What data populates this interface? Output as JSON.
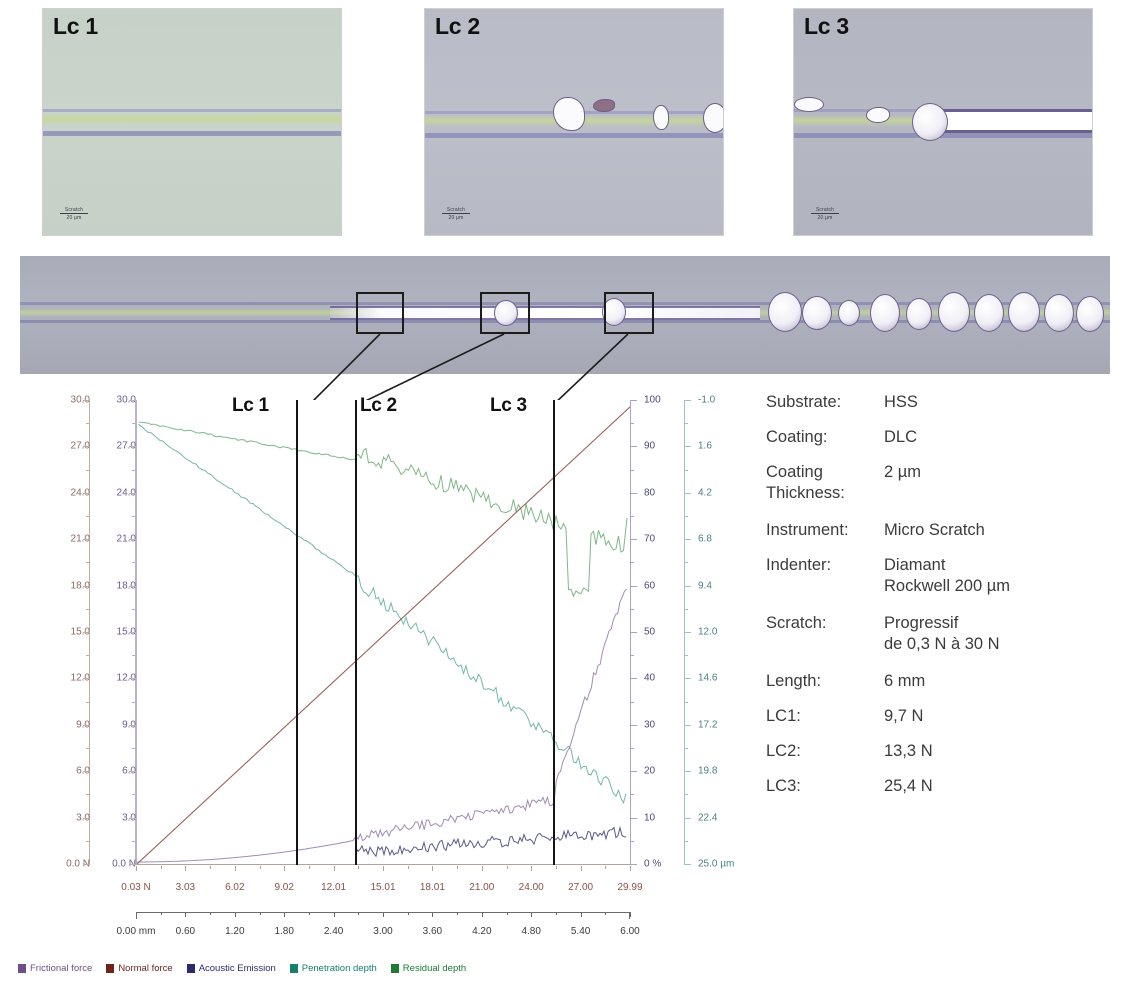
{
  "micrographs": [
    {
      "label": "Lc 1",
      "scale_value": "20 µm",
      "scale_top": "Scratch"
    },
    {
      "label": "Lc 2",
      "scale_value": "20 µm",
      "scale_top": "Scratch"
    },
    {
      "label": "Lc 3",
      "scale_value": "20 µm",
      "scale_top": "Scratch"
    }
  ],
  "chart_data": {
    "type": "line",
    "title": "",
    "xlabel": "",
    "ylabel": "",
    "grid": true,
    "legend_position": "bottom",
    "axes": {
      "normal_force": {
        "label": "0.0 N",
        "unit": "N",
        "color": "#8c6a62",
        "range": [
          0,
          30
        ],
        "ticks": [
          "30.0",
          "27.0",
          "24.0",
          "21.0",
          "18.0",
          "15.0",
          "12.0",
          "9.0",
          "6.0",
          "3.0",
          "0.0 N"
        ]
      },
      "frictional_force": {
        "label": "0.0 N",
        "unit": "N",
        "color": "#6d5d8f",
        "range": [
          0,
          30
        ],
        "ticks": [
          "30.0",
          "27.0",
          "24.0",
          "21.0",
          "18.0",
          "15.0",
          "12.0",
          "9.0",
          "6.0",
          "3.0",
          "0.0 N"
        ]
      },
      "acoustic_emission": {
        "unit": "%",
        "color": "#4d4a7a",
        "range": [
          0,
          100
        ],
        "ticks": [
          "100",
          "90",
          "80",
          "70",
          "60",
          "50",
          "40",
          "30",
          "20",
          "10",
          "0 %"
        ]
      },
      "depth": {
        "unit": "µm",
        "color": "#4b7f84",
        "range": [
          -1.0,
          25.0
        ],
        "ticks": [
          "-1.0",
          "1.6",
          "4.2",
          "6.8",
          "9.4",
          "12.0",
          "14.6",
          "17.2",
          "19.8",
          "22.4",
          "25.0 µm"
        ]
      },
      "x_force": {
        "unit": "N",
        "color": "#8c4f46",
        "ticks": [
          "0.03 N",
          "3.03",
          "6.02",
          "9.02",
          "12.01",
          "15.01",
          "18.01",
          "21.00",
          "24.00",
          "27.00",
          "29.99"
        ]
      },
      "x_position": {
        "unit": "mm",
        "color": "#3a3a3a",
        "ticks": [
          "0.00 mm",
          "0.60",
          "1.20",
          "1.80",
          "2.40",
          "3.00",
          "3.60",
          "4.20",
          "4.80",
          "5.40",
          "6.00"
        ]
      }
    },
    "markers": [
      {
        "label": "Lc 1",
        "force_n": 9.7,
        "x_fraction": 0.323
      },
      {
        "label": "Lc 2",
        "force_n": 13.3,
        "x_fraction": 0.443
      },
      {
        "label": "Lc 3",
        "force_n": 25.4,
        "x_fraction": 0.845
      }
    ],
    "series": [
      {
        "name": "Frictional force",
        "color": "#7b5a93"
      },
      {
        "name": "Normal force",
        "color": "#7a2b24"
      },
      {
        "name": "Acoustic Emission",
        "color": "#2f2f6e"
      },
      {
        "name": "Penetration depth",
        "color": "#1f8a78"
      },
      {
        "name": "Residual depth",
        "color": "#2f8a3f"
      }
    ],
    "legend": [
      {
        "label": "Frictional force",
        "color": "#6f4f88"
      },
      {
        "label": "Normal force",
        "color": "#6e241d"
      },
      {
        "label": "Acoustic Emission",
        "color": "#2b2b6b"
      },
      {
        "label": "Penetration depth",
        "color": "#15806d"
      },
      {
        "label": "Residual depth",
        "color": "#1f7a33"
      }
    ]
  },
  "info": {
    "rows": [
      {
        "key": "Substrate:",
        "value": "HSS"
      },
      {
        "key": "Coating:",
        "value": "DLC"
      },
      {
        "key": "Coating\nThickness:",
        "value": "2 µm"
      },
      {
        "key": "Instrument:",
        "value": "Micro Scratch"
      },
      {
        "key": "Indenter:",
        "value": "Diamant\nRockwell 200 µm"
      },
      {
        "key": "Scratch:",
        "value": "Progressif\nde 0,3 N à 30 N"
      },
      {
        "key": "Length:",
        "value": "6 mm"
      },
      {
        "key": "LC1:",
        "value": "9,7 N"
      },
      {
        "key": "LC2:",
        "value": "13,3 N"
      },
      {
        "key": "LC3:",
        "value": "25,4 N"
      }
    ]
  }
}
